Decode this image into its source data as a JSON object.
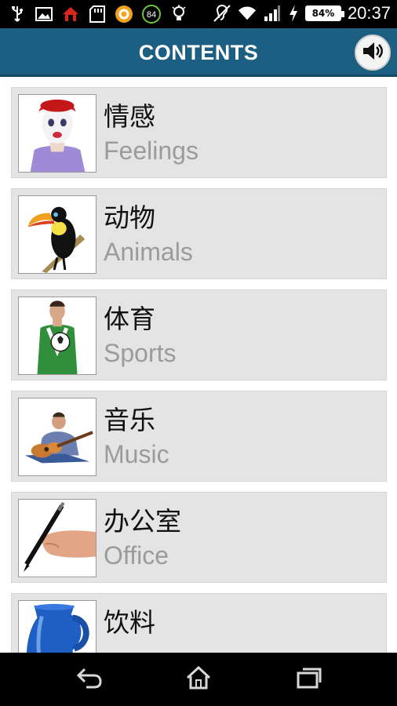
{
  "status_bar": {
    "time": "20:37",
    "battery": "84%",
    "badge": "84",
    "icons": [
      "usb-icon",
      "image-icon",
      "home-alert-icon",
      "sd-card-icon",
      "app-icon",
      "badge-84-icon",
      "bulb-icon",
      "hearing-icon",
      "wifi-icon",
      "signal-icon",
      "charging-icon"
    ]
  },
  "header": {
    "title": "CONTENTS",
    "sound_icon": "speaker-icon"
  },
  "items": [
    {
      "cn": "情感",
      "en": "Feelings"
    },
    {
      "cn": "动物",
      "en": "Animals"
    },
    {
      "cn": "体育",
      "en": "Sports"
    },
    {
      "cn": "音乐",
      "en": "Music"
    },
    {
      "cn": "办公室",
      "en": "Office"
    },
    {
      "cn": "饮料",
      "en": ""
    }
  ],
  "nav": {
    "icons": [
      "back-icon",
      "home-icon",
      "recents-icon"
    ]
  }
}
